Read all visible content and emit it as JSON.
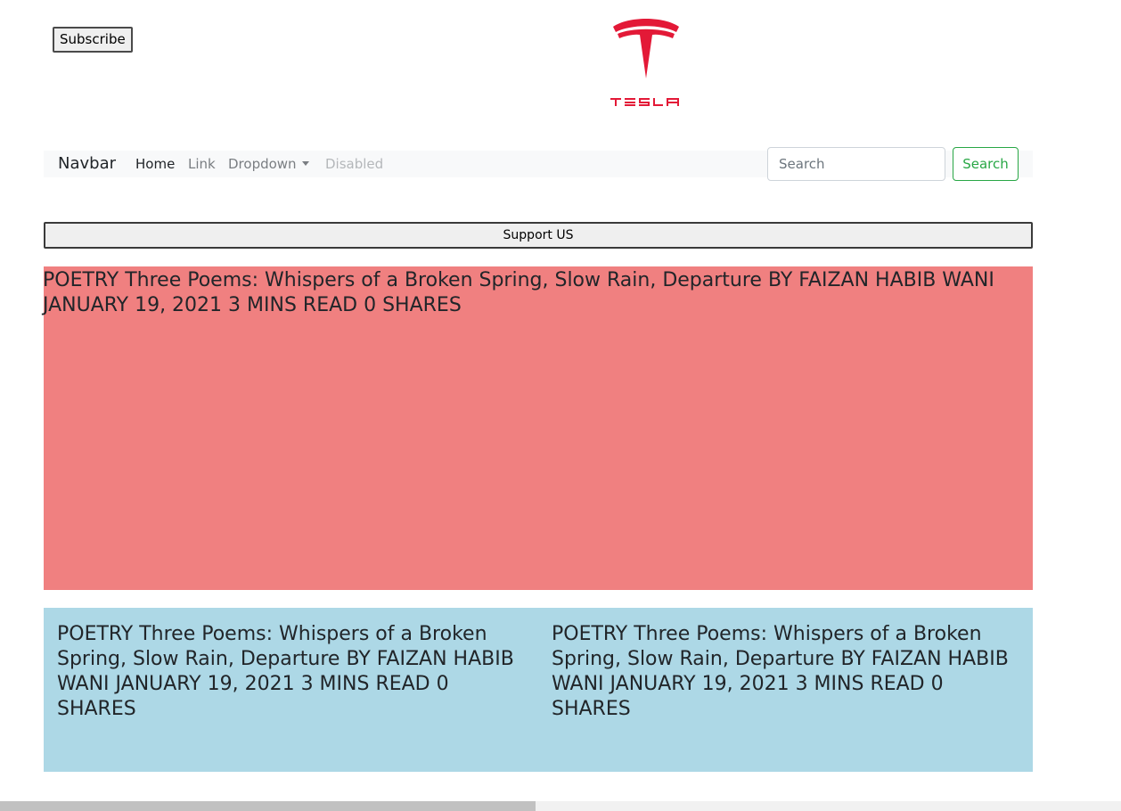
{
  "header": {
    "subscribe_label": "Subscribe",
    "logo_brand": "TESLA",
    "logo_color": "#e31937"
  },
  "navbar": {
    "brand": "Navbar",
    "links": {
      "home": "Home",
      "link": "Link",
      "dropdown": "Dropdown",
      "disabled": "Disabled"
    },
    "search": {
      "placeholder": "Search",
      "value": "",
      "button_label": "Search"
    },
    "background": "#f8f9fa",
    "search_button_color": "#28a745"
  },
  "support_label": "Support US",
  "feature": {
    "text": "POETRY Three Poems: Whispers of a Broken Spring, Slow Rain, Departure BY FAIZAN HABIB WANI JANUARY 19, 2021 3 MINS READ 0 SHARES",
    "background": "#f08080"
  },
  "cards": {
    "background": "#add8e6",
    "items": [
      {
        "text": "POETRY Three Poems: Whispers of a Broken Spring, Slow Rain, Departure BY FAIZAN HABIB WANI JANUARY 19, 2021 3 MINS READ 0 SHARES"
      },
      {
        "text": "POETRY Three Poems: Whispers of a Broken Spring, Slow Rain, Departure BY FAIZAN HABIB WANI JANUARY 19, 2021 3 MINS READ 0 SHARES"
      }
    ]
  }
}
